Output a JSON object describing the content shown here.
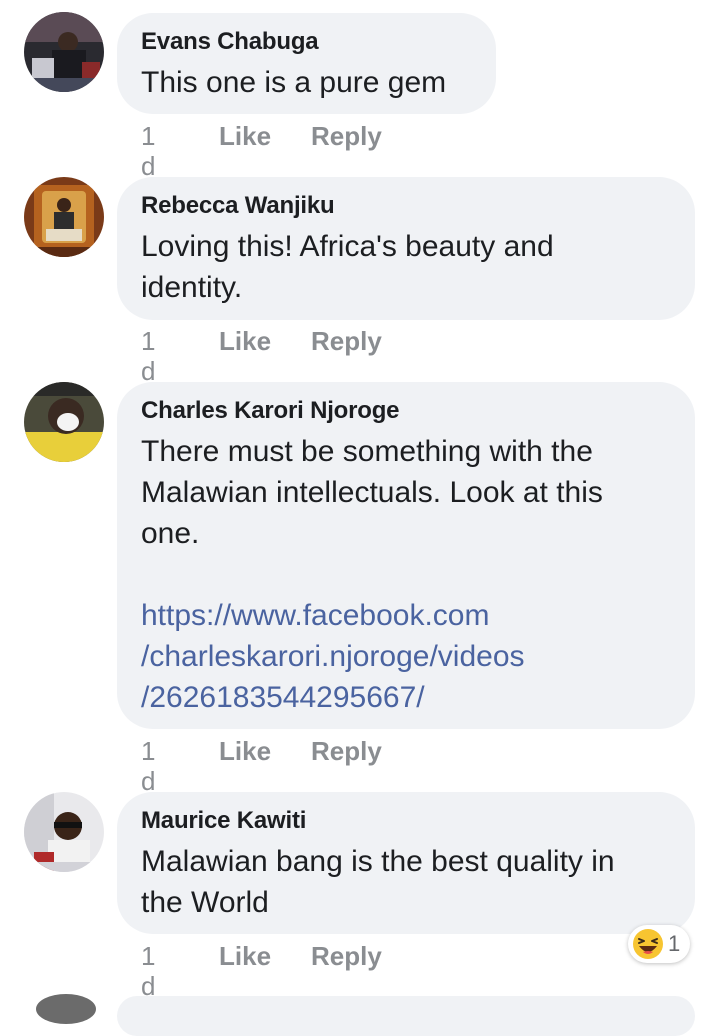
{
  "comments": [
    {
      "name": "Evans Chabuga",
      "lines": [
        "This one is a pure gem"
      ],
      "time": "1 d",
      "like": "Like",
      "reply": "Reply"
    },
    {
      "name": "Rebecca Wanjiku",
      "lines": [
        "Loving this! Africa's beauty and",
        "identity."
      ],
      "time": "1 d",
      "like": "Like",
      "reply": "Reply"
    },
    {
      "name": "Charles Karori Njoroge",
      "lines": [
        "There must be something with the",
        "Malawian intellectuals. Look at this",
        "one."
      ],
      "link_lines": [
        "https://www.facebook.com",
        "/charleskarori.njoroge/videos",
        "/2626183544295667/"
      ],
      "time": "1 d",
      "like": "Like",
      "reply": "Reply"
    },
    {
      "name": "Maurice Kawiti",
      "lines": [
        "Malawian bang is the best quality in",
        "the World"
      ],
      "time": "1 d",
      "like": "Like",
      "reply": "Reply",
      "reaction": {
        "icon": "laughing-emoji-icon",
        "count": "1"
      }
    }
  ],
  "colors": {
    "bubble": "#f0f2f5",
    "link": "#4a63a0",
    "meta": "#8a8d91"
  }
}
